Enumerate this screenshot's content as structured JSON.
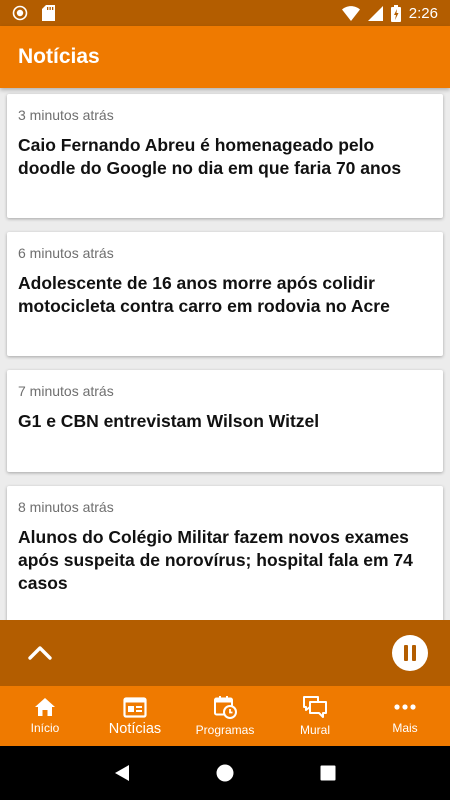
{
  "status_bar": {
    "time": "2:26",
    "battery_label": "Z"
  },
  "app_bar": {
    "title": "Notícias"
  },
  "feed": {
    "items": [
      {
        "time": "3 minutos atrás",
        "title": "Caio Fernando Abreu é homenageado pelo doodle do Google no dia em que faria 70 anos"
      },
      {
        "time": "6 minutos atrás",
        "title": "Adolescente de 16 anos morre após colidir motocicleta contra carro em rodovia no Acre"
      },
      {
        "time": "7 minutos atrás",
        "title": "G1 e CBN entrevistam Wilson Witzel"
      },
      {
        "time": "8 minutos atrás",
        "title": "Alunos do Colégio Militar fazem novos exames após suspeita de norovírus; hospital fala em 74 casos"
      }
    ]
  },
  "player": {
    "expand_icon": "chevron-up-icon",
    "pause_icon": "pause-icon"
  },
  "bottom_nav": {
    "items": [
      {
        "label": "Início",
        "icon": "home-icon"
      },
      {
        "label": "Notícias",
        "icon": "newspaper-icon",
        "active": true
      },
      {
        "label": "Programas",
        "icon": "calendar-clock-icon"
      },
      {
        "label": "Mural",
        "icon": "chat-icon"
      },
      {
        "label": "Mais",
        "icon": "more-dots-icon"
      }
    ]
  },
  "colors": {
    "primary": "#ef7a00",
    "primary_dark": "#b35d00"
  }
}
